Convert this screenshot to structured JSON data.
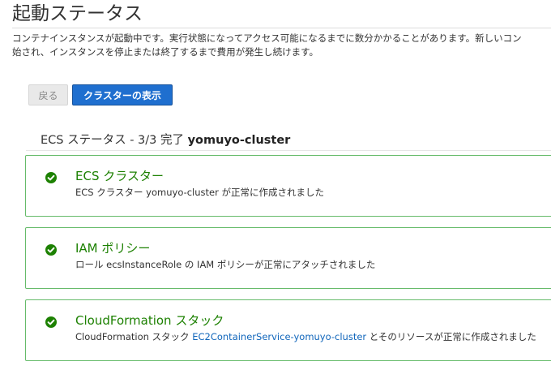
{
  "page": {
    "title": "起動ステータス",
    "description_line1": "コンテナインスタンスが起動中です。実行状態になってアクセス可能になるまでに数分かかることがあります。新しいコン",
    "description_line2": "始され、インスタンスを停止または終了するまで費用が発生し続けます。"
  },
  "buttons": {
    "back_label": "戻る",
    "view_cluster_label": "クラスターの表示"
  },
  "ecs_status": {
    "heading_prefix": "ECS ステータス - 3/3 完了",
    "cluster_name": "yomuyo-cluster"
  },
  "cards": [
    {
      "title": "ECS クラスター",
      "body": "ECS クラスター yomuyo-cluster が正常に作成されました",
      "icon": "check-circle-icon",
      "color": "#1d8102"
    },
    {
      "title": "IAM ポリシー",
      "body": "ロール ecsInstanceRole の IAM ポリシーが正常にアタッチされました",
      "icon": "check-circle-icon",
      "color": "#1d8102"
    },
    {
      "title": "CloudFormation スタック",
      "body_prefix": "CloudFormation スタック",
      "body_link": "EC2ContainerService-yomuyo-cluster",
      "body_suffix": "とそのリソースが正常に作成されました",
      "icon": "check-circle-icon",
      "color": "#1d8102"
    }
  ],
  "colors": {
    "primary": "#1f6fcf",
    "success": "#1d8102",
    "success_border": "#66bb6a",
    "link": "#1166bb"
  }
}
